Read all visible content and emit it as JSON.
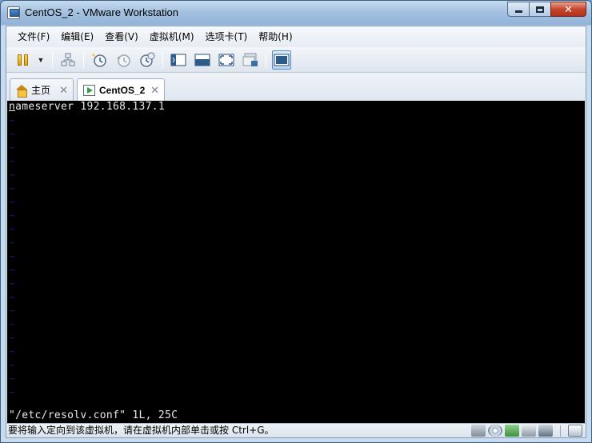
{
  "window": {
    "title": "CentOS_2 - VMware Workstation",
    "minimize_icon": "minimize-icon",
    "maximize_icon": "maximize-icon",
    "close_glyph": "✕"
  },
  "menu": {
    "items": [
      "文件(F)",
      "编辑(E)",
      "查看(V)",
      "虚拟机(M)",
      "选项卡(T)",
      "帮助(H)"
    ]
  },
  "toolbar": {
    "buttons": [
      {
        "name": "power-pause-icon"
      },
      {
        "name": "dropdown-arrow-icon"
      },
      {
        "name": "network-icon"
      },
      {
        "name": "snapshot-take-icon"
      },
      {
        "name": "snapshot-revert-icon"
      },
      {
        "name": "snapshot-manager-icon"
      },
      {
        "name": "console-view-icon"
      },
      {
        "name": "quick-switch-icon"
      },
      {
        "name": "full-screen-icon"
      },
      {
        "name": "unity-icon"
      },
      {
        "name": "thumbnail-bar-icon"
      }
    ]
  },
  "tabs": [
    {
      "label": "主页",
      "icon": "home-icon",
      "close": "✕"
    },
    {
      "label": "CentOS_2",
      "icon": "vm-running-icon",
      "close": "✕",
      "active": true
    }
  ],
  "console": {
    "line1_first": "n",
    "line1_rest": "ameserver 192.168.137.1",
    "tilde": "~",
    "status_line": "\"/etc/resolv.conf\" 1L, 25C"
  },
  "statusbar": {
    "message": "要将输入定向到该虚拟机，请在虚拟机内部单击或按 Ctrl+G。",
    "icons": [
      "hard-disk-icon",
      "cd-dvd-icon",
      "network-adapter-icon",
      "printer-icon",
      "sound-icon",
      "message-log-icon"
    ]
  },
  "colors": {
    "console_bg": "#000000",
    "console_text": "#e8e8e8",
    "tilde": "#1c1ca8"
  }
}
